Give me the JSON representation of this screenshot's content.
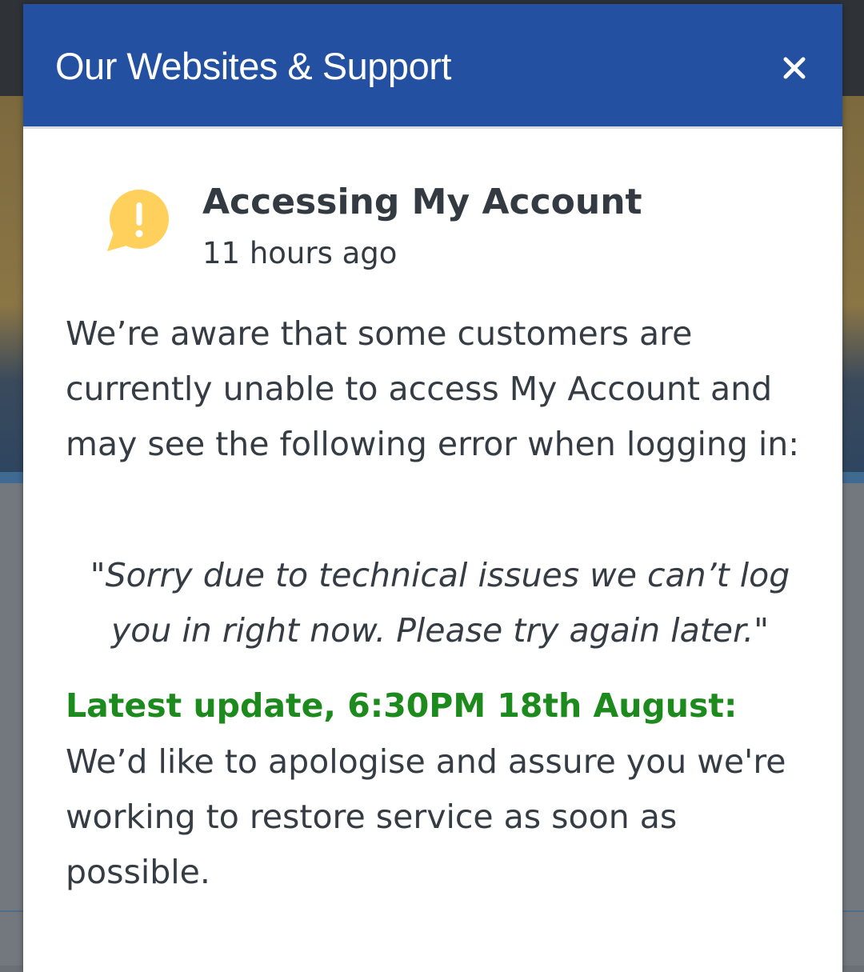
{
  "modal": {
    "title": "Our Websites & Support",
    "close_label": "close"
  },
  "notice": {
    "title": "Accessing My Account",
    "time": "11 hours ago",
    "intro": "We’re aware that some customers are currently unable to access My Account and may see the following error when logging in:",
    "quote": "\"Sorry due to technical issues we can’t log you in right now. Please try again later.\"",
    "update_label": "Latest update, 6:30PM 18th August:",
    "update_text": "We’d like to apologise and assure you we're working to restore service as soon as possible."
  },
  "icons": {
    "warning": "warning-speech-bubble-icon",
    "close": "close-icon"
  },
  "colors": {
    "header": "#2350a0",
    "warning": "#ffd15c",
    "update": "#1c8a1c",
    "text": "#353c44"
  }
}
